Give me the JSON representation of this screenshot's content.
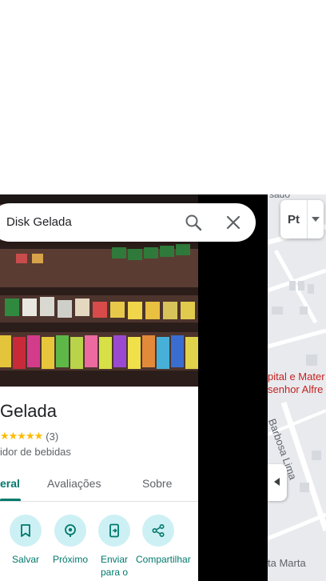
{
  "search": {
    "query": "Disk Gelada",
    "search_icon": "search-icon",
    "close_icon": "close-icon"
  },
  "place": {
    "title": "Gelada",
    "stars": "★★★★★",
    "rating_value": 5,
    "review_count": "(3)",
    "category": "idor de bebidas"
  },
  "tabs": [
    {
      "label": "eral",
      "selected": true
    },
    {
      "label": "Avaliações",
      "selected": false
    },
    {
      "label": "Sobre",
      "selected": false
    }
  ],
  "actions": [
    {
      "label": "Salvar",
      "icon": "bookmark-icon"
    },
    {
      "label": "Próximo",
      "icon": "nearby-icon"
    },
    {
      "label": "Enviar para o",
      "icon": "send-to-phone-icon"
    },
    {
      "label": "Compartilhar",
      "icon": "share-icon"
    }
  ],
  "map": {
    "top_label": "sado",
    "hospital_line1": "pital e Mater",
    "hospital_line2": "senhor Alfre",
    "street_label": "Barbosa Lima",
    "bottom_label": "ta Marta",
    "layer_label": "Pt"
  },
  "colors": {
    "accent": "#00796b",
    "action_bg": "#cdf0f4",
    "star": "#fbbc04",
    "poi_red": "#c5221f"
  }
}
